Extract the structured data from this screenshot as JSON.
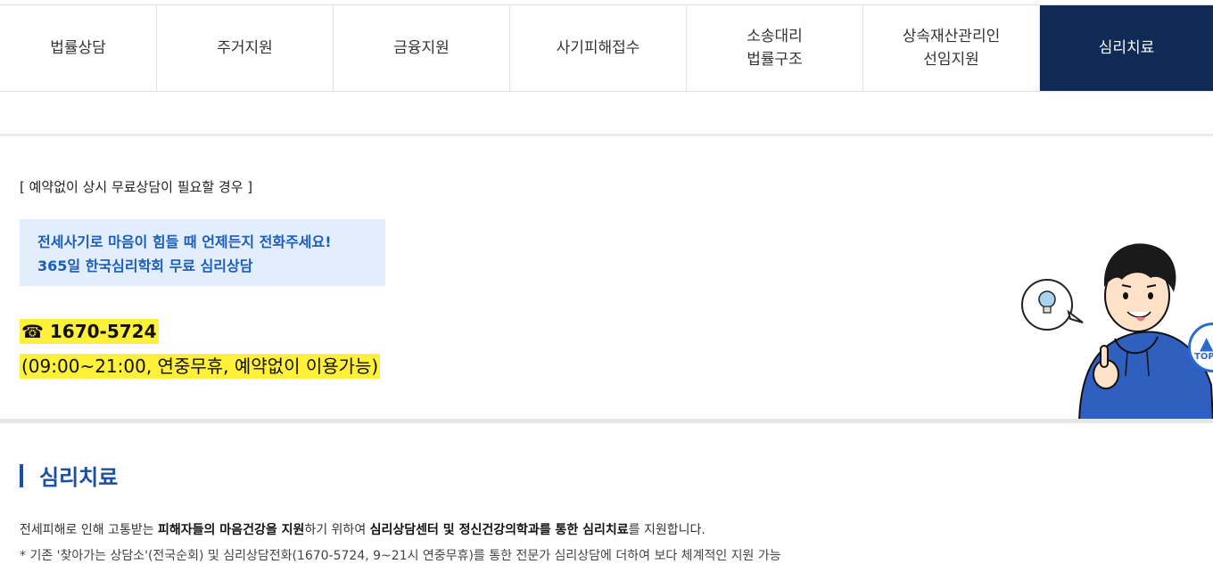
{
  "tabs": [
    {
      "label": "법률상담",
      "active": false
    },
    {
      "label": "주거지원",
      "active": false
    },
    {
      "label": "금융지원",
      "active": false
    },
    {
      "label": "사기피해접수",
      "active": false
    },
    {
      "label": "소송대리\n법률구조",
      "active": false
    },
    {
      "label": "상속재산관리인\n선임지원",
      "active": false
    },
    {
      "label": "심리치료",
      "active": true
    }
  ],
  "notice": {
    "title": "[ 예약없이 상시 무료상담이 필요할 경우 ]",
    "callout_line1": "전세사기로 마음이 힘들 때 언제든지 전화주세요!",
    "callout_line2": "365일 한국심리학회 무료 심리상담",
    "phone": "☎ 1670-5724",
    "hours": "(09:00~21:00, 연중무휴, 예약없이 이용가능)"
  },
  "scroll_top": {
    "label": "TOP"
  },
  "section": {
    "title": "심리치료",
    "desc_parts": [
      "전세피해로 인해 고통받는 ",
      "피해자들의 마음건강을 지원",
      "하기 위하여 ",
      "심리상담센터 및 정신건강의학과를 통한 심리치료",
      "를 지원합니다."
    ],
    "note": "* 기존 '찾아가는 상담소'(전국순회) 및 심리상담전화(1670-5724, 9~21시 연중무휴)를 통한 전문가 심리상담에 더하여 보다 체계적인 지원 가능"
  },
  "colors": {
    "active_tab": "#0e2a55",
    "accent_blue": "#1a4fa3",
    "highlight": "#fff03a",
    "callout_bg": "#e3eefc"
  }
}
